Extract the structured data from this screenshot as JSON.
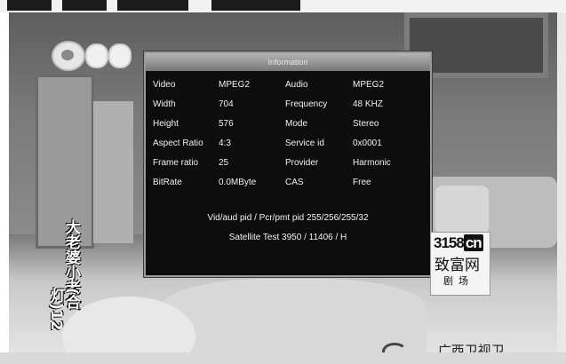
{
  "panel": {
    "title": "Information",
    "rows": [
      {
        "l1": "Video",
        "v1": "MPEG2",
        "l2": "Audio",
        "v2": "MPEG2"
      },
      {
        "l1": "Width",
        "v1": "704",
        "l2": "Frequency",
        "v2": "48 KHZ"
      },
      {
        "l1": "Height",
        "v1": "576",
        "l2": "Mode",
        "v2": "Stereo"
      },
      {
        "l1": "Aspect Ratio",
        "v1": "4:3",
        "l2": "Service id",
        "v2": "0x0001"
      },
      {
        "l1": "Frame ratio",
        "v1": "25",
        "l2": "Provider",
        "v2": "Harmonic"
      },
      {
        "l1": "BitRate",
        "v1": "0.0MByte",
        "l2": "CAS",
        "v2": "Free"
      }
    ],
    "pid_line": "Vid/aud pid / Pcr/pmt pid  255/256/255/32",
    "satellite_line": "Satellite Test  3950 / 11406 / H"
  },
  "overlay": {
    "subtitle_vertical": "大老婆小老公",
    "subtitle_episode": "(合灯)12"
  },
  "watermark": {
    "site": "3158",
    "tld": "cn",
    "name": "致富网",
    "sub": "剧场"
  },
  "ticker": {
    "channel_text": "广西卫视卫"
  },
  "colors": {
    "panel_bg": "#0d0d0d",
    "panel_text": "#f2f2f2",
    "header_gradient_top": "#b5b5b5"
  }
}
